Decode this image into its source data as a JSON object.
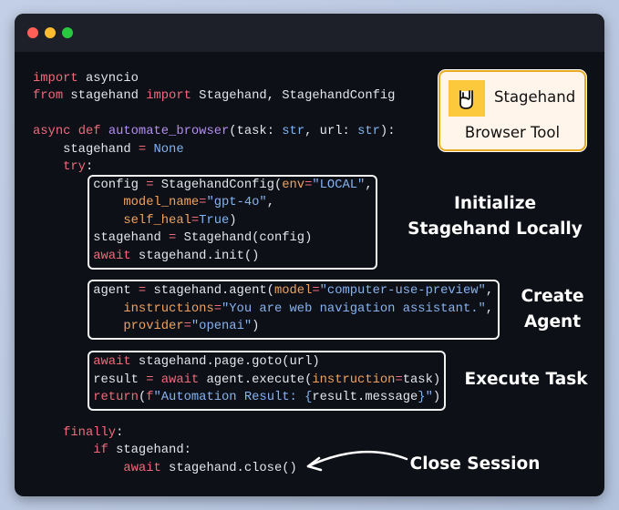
{
  "window": {
    "controls": [
      "close",
      "minimize",
      "maximize"
    ],
    "colors": {
      "close": "#fe5f57",
      "minimize": "#febc2e",
      "maximize": "#28c840"
    }
  },
  "code_lines": [
    [
      [
        "import",
        "kw"
      ],
      [
        " asyncio",
        "tx"
      ]
    ],
    [
      [
        "from",
        "kw"
      ],
      [
        " stagehand ",
        "tx"
      ],
      [
        "import",
        "kw"
      ],
      [
        " Stagehand, StagehandConfig",
        "tx"
      ]
    ],
    [],
    [
      [
        "async",
        "kw"
      ],
      [
        " ",
        "tx"
      ],
      [
        "def",
        "kw"
      ],
      [
        " ",
        "tx"
      ],
      [
        "automate_browser",
        "fn"
      ],
      [
        "(task: ",
        "tx"
      ],
      [
        "str",
        "bl"
      ],
      [
        ", url: ",
        "tx"
      ],
      [
        "str",
        "bl"
      ],
      [
        "):",
        "tx"
      ]
    ],
    [
      [
        "    stagehand ",
        "tx"
      ],
      [
        "=",
        "kw"
      ],
      [
        " ",
        "tx"
      ],
      [
        "None",
        "bl"
      ]
    ],
    [
      [
        "    ",
        "tx"
      ],
      [
        "try",
        "kw"
      ],
      [
        ":",
        "tx"
      ]
    ],
    [
      [
        "        config ",
        "tx"
      ],
      [
        "=",
        "kw"
      ],
      [
        " StagehandConfig(",
        "tx"
      ],
      [
        "env",
        "pa"
      ],
      [
        "=",
        "kw"
      ],
      [
        "\"LOCAL\"",
        "st"
      ],
      [
        ",",
        "tx"
      ]
    ],
    [
      [
        "            ",
        "tx"
      ],
      [
        "model_name",
        "pa"
      ],
      [
        "=",
        "kw"
      ],
      [
        "\"gpt-4o\"",
        "st"
      ],
      [
        ",",
        "tx"
      ]
    ],
    [
      [
        "            ",
        "tx"
      ],
      [
        "self_heal",
        "pa"
      ],
      [
        "=",
        "kw"
      ],
      [
        "True",
        "bl"
      ],
      [
        ")",
        "tx"
      ]
    ],
    [
      [
        "        stagehand ",
        "tx"
      ],
      [
        "=",
        "kw"
      ],
      [
        " Stagehand(config)",
        "tx"
      ]
    ],
    [
      [
        "        ",
        "tx"
      ],
      [
        "await",
        "kw"
      ],
      [
        " stagehand.init()",
        "tx"
      ]
    ],
    [],
    [
      [
        "        agent ",
        "tx"
      ],
      [
        "=",
        "kw"
      ],
      [
        " stagehand.agent(",
        "tx"
      ],
      [
        "model",
        "pa"
      ],
      [
        "=",
        "kw"
      ],
      [
        "\"computer-use-preview\"",
        "st"
      ],
      [
        ",",
        "tx"
      ]
    ],
    [
      [
        "            ",
        "tx"
      ],
      [
        "instructions",
        "pa"
      ],
      [
        "=",
        "kw"
      ],
      [
        "\"You are web navigation assistant.\"",
        "st"
      ],
      [
        ",",
        "tx"
      ]
    ],
    [
      [
        "            ",
        "tx"
      ],
      [
        "provider",
        "pa"
      ],
      [
        "=",
        "kw"
      ],
      [
        "\"openai\"",
        "st"
      ],
      [
        ")",
        "tx"
      ]
    ],
    [],
    [
      [
        "        ",
        "tx"
      ],
      [
        "await",
        "kw"
      ],
      [
        " stagehand.page.goto(url)",
        "tx"
      ]
    ],
    [
      [
        "        result ",
        "tx"
      ],
      [
        "=",
        "kw"
      ],
      [
        " ",
        "tx"
      ],
      [
        "await",
        "kw"
      ],
      [
        " agent.execute(",
        "tx"
      ],
      [
        "instruction",
        "pa"
      ],
      [
        "=",
        "kw"
      ],
      [
        "task)",
        "tx"
      ]
    ],
    [
      [
        "        ",
        "tx"
      ],
      [
        "return",
        "kw"
      ],
      [
        "(",
        "tx"
      ],
      [
        "f",
        "kw"
      ],
      [
        "\"Automation Result: ",
        "st"
      ],
      [
        "{",
        "bl"
      ],
      [
        "result.message",
        "tx"
      ],
      [
        "}",
        "bl"
      ],
      [
        "\"",
        "st"
      ],
      [
        ")",
        "tx"
      ]
    ],
    [],
    [
      [
        "    ",
        "tx"
      ],
      [
        "finally",
        "kw"
      ],
      [
        ":",
        "tx"
      ]
    ],
    [
      [
        "        ",
        "tx"
      ],
      [
        "if",
        "kw"
      ],
      [
        " stagehand:",
        "tx"
      ]
    ],
    [
      [
        "            ",
        "tx"
      ],
      [
        "await",
        "kw"
      ],
      [
        " stagehand.close()",
        "tx"
      ]
    ]
  ],
  "annotations": {
    "initialize": [
      "Initialize",
      "Stagehand Locally"
    ],
    "create_agent": [
      "Create",
      "Agent"
    ],
    "execute": "Execute Task",
    "close": "Close Session"
  },
  "card": {
    "name": "Stagehand",
    "subtitle": "Browser Tool",
    "icon": "rock-hand-icon",
    "accent": "#fcc83c",
    "border": "#e8a923"
  }
}
